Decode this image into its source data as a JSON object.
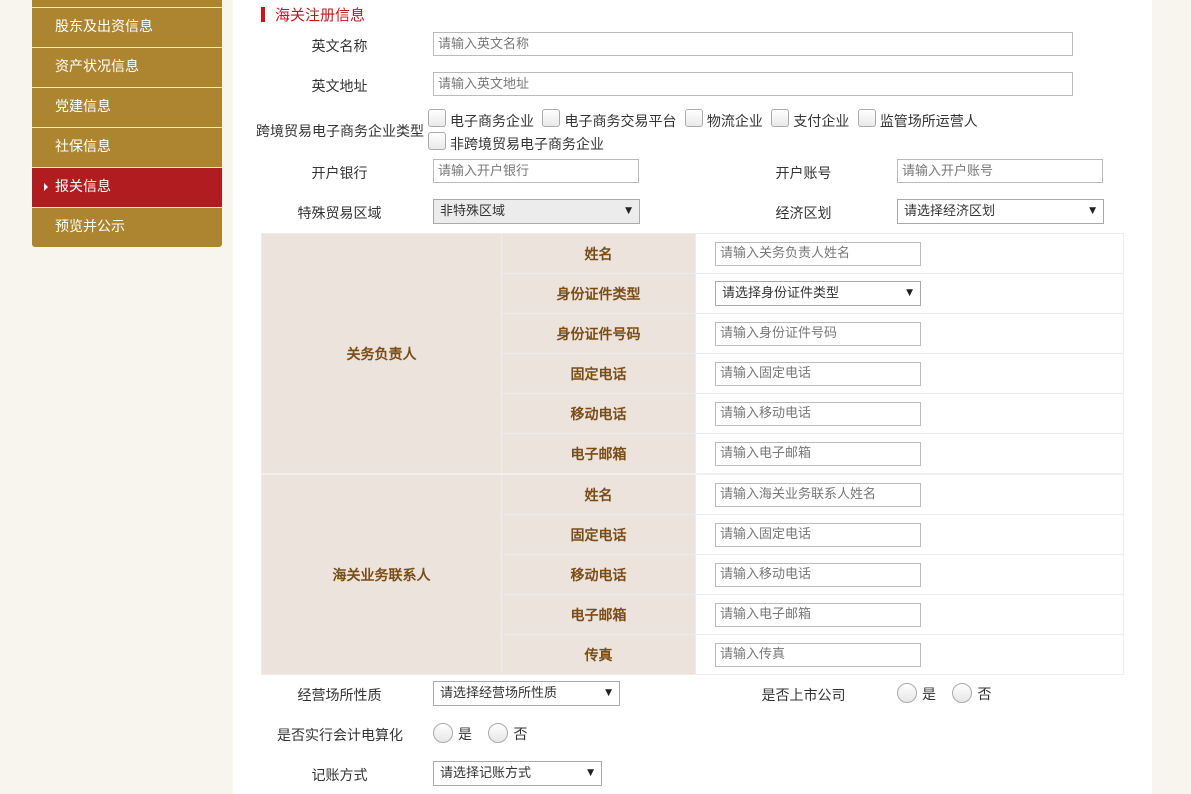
{
  "sidebar": {
    "items": [
      {
        "label": "股东及出资信息",
        "active": false
      },
      {
        "label": "资产状况信息",
        "active": false
      },
      {
        "label": "党建信息",
        "active": false
      },
      {
        "label": "社保信息",
        "active": false
      },
      {
        "label": "报关信息",
        "active": true
      },
      {
        "label": "预览并公示",
        "active": false
      }
    ]
  },
  "section_title": "海关注册信息",
  "fields": {
    "en_name": {
      "label": "英文名称",
      "placeholder": "请输入英文名称"
    },
    "en_addr": {
      "label": "英文地址",
      "placeholder": "请输入英文地址"
    },
    "ecommerce_type": {
      "label": "跨境贸易电子商务企业类型",
      "options": [
        "电子商务企业",
        "电子商务交易平台",
        "物流企业",
        "支付企业",
        "监管场所运营人",
        "非跨境贸易电子商务企业"
      ]
    },
    "bank": {
      "label": "开户银行",
      "placeholder": "请输入开户银行"
    },
    "account": {
      "label": "开户账号",
      "placeholder": "请输入开户账号"
    },
    "trade_zone": {
      "label": "特殊贸易区域",
      "value": "非特殊区域"
    },
    "econ_zone": {
      "label": "经济区划",
      "value": "请选择经济区划"
    }
  },
  "customs_head": {
    "group": "关务负责人",
    "rows": [
      {
        "label": "姓名",
        "placeholder": "请输入关务负责人姓名"
      },
      {
        "label": "身份证件类型",
        "select": "请选择身份证件类型"
      },
      {
        "label": "身份证件号码",
        "placeholder": "请输入身份证件号码"
      },
      {
        "label": "固定电话",
        "placeholder": "请输入固定电话"
      },
      {
        "label": "移动电话",
        "placeholder": "请输入移动电话"
      },
      {
        "label": "电子邮箱",
        "placeholder": "请输入电子邮箱"
      }
    ]
  },
  "customs_contact": {
    "group": "海关业务联系人",
    "rows": [
      {
        "label": "姓名",
        "placeholder": "请输入海关业务联系人姓名"
      },
      {
        "label": "固定电话",
        "placeholder": "请输入固定电话"
      },
      {
        "label": "移动电话",
        "placeholder": "请输入移动电话"
      },
      {
        "label": "电子邮箱",
        "placeholder": "请输入电子邮箱"
      },
      {
        "label": "传真",
        "placeholder": "请输入传真"
      }
    ]
  },
  "bottom": {
    "venue": {
      "label": "经营场所性质",
      "value": "请选择经营场所性质"
    },
    "listed": {
      "label": "是否上市公司",
      "yes": "是",
      "no": "否"
    },
    "accounting": {
      "label": "是否实行会计电算化",
      "yes": "是",
      "no": "否"
    },
    "bookkeeping": {
      "label": "记账方式",
      "value": "请选择记账方式"
    }
  },
  "icons": {
    "caret": "dropdown-caret-icon",
    "arrow": "active-arrow-icon"
  }
}
